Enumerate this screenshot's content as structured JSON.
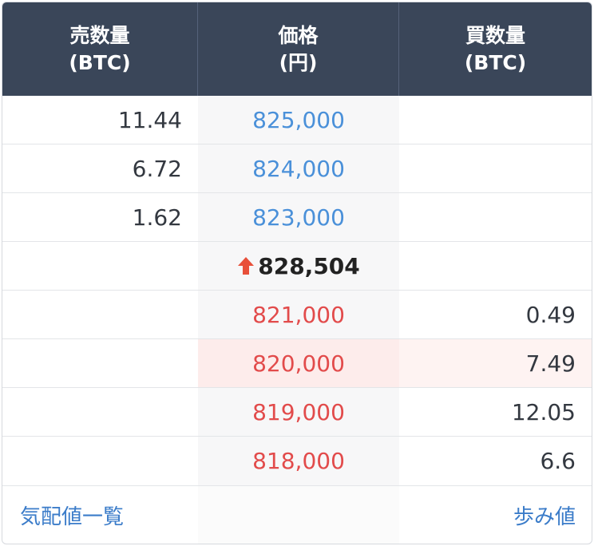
{
  "header": {
    "sell_qty": {
      "line1": "売数量",
      "line2": "(BTC)"
    },
    "price": {
      "line1": "価格",
      "line2": "(円)"
    },
    "buy_qty": {
      "line1": "買数量",
      "line2": "(BTC)"
    }
  },
  "rows": [
    {
      "sell": "11.44",
      "price": "825,000",
      "buy": "",
      "kind": "ask"
    },
    {
      "sell": "6.72",
      "price": "824,000",
      "buy": "",
      "kind": "ask"
    },
    {
      "sell": "1.62",
      "price": "823,000",
      "buy": "",
      "kind": "ask"
    },
    {
      "sell": "",
      "price": "828,504",
      "buy": "",
      "kind": "last",
      "icon": "arrow-up-icon"
    },
    {
      "sell": "",
      "price": "821,000",
      "buy": "0.49",
      "kind": "bid"
    },
    {
      "sell": "",
      "price": "820,000",
      "buy": "7.49",
      "kind": "bid",
      "highlight": true
    },
    {
      "sell": "",
      "price": "819,000",
      "buy": "12.05",
      "kind": "bid"
    },
    {
      "sell": "",
      "price": "818,000",
      "buy": "6.6",
      "kind": "bid"
    }
  ],
  "footer": {
    "left_link": "気配値一覧",
    "right_link": "歩み値"
  },
  "colors": {
    "header_bg": "#3a4659",
    "ask": "#4a90d9",
    "bid": "#e24b4b",
    "arrow": "#e8503a",
    "link": "#3b7cc9"
  }
}
